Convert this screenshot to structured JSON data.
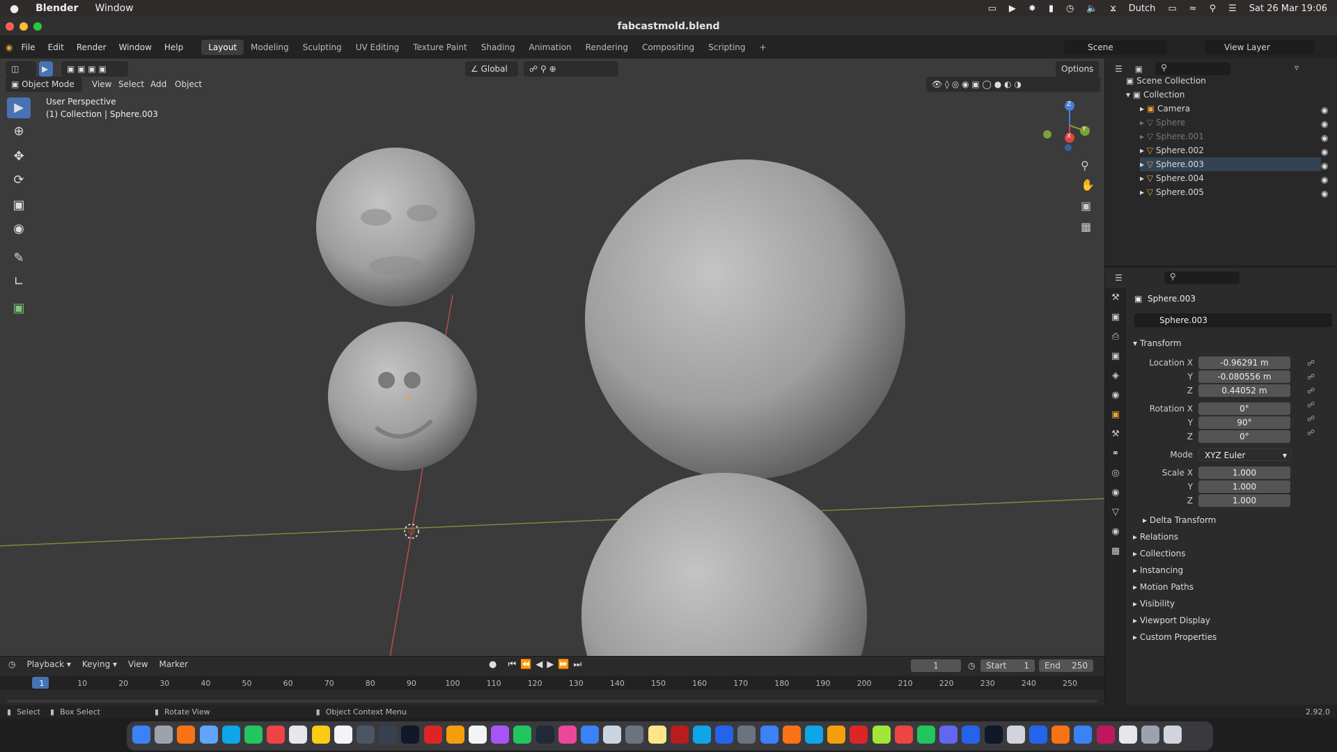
{
  "macbar": {
    "apple": "",
    "app": "Blender",
    "menu": "Window",
    "keyboard": "Dutch",
    "datetime": "Sat 26 Mar  19:06"
  },
  "window": {
    "title": "fabcastmold.blend"
  },
  "topbar": {
    "menus": [
      "File",
      "Edit",
      "Render",
      "Window",
      "Help"
    ],
    "workspaces": [
      "Layout",
      "Modeling",
      "Sculpting",
      "UV Editing",
      "Texture Paint",
      "Shading",
      "Animation",
      "Rendering",
      "Compositing",
      "Scripting"
    ],
    "active_workspace": "Layout",
    "scene": "Scene",
    "view_layer": "View Layer"
  },
  "viewport": {
    "mode": "Object Mode",
    "menus": [
      "View",
      "Select",
      "Add",
      "Object"
    ],
    "orientation": "Global",
    "options": "Options",
    "info_line1": "User Perspective",
    "info_line2": "(1) Collection | Sphere.003"
  },
  "gizmo": {
    "x": "X",
    "y": "Y",
    "z": "Z"
  },
  "outliner": {
    "root": "Scene Collection",
    "collection": "Collection",
    "items": [
      {
        "name": "Camera"
      },
      {
        "name": "Sphere"
      },
      {
        "name": "Sphere.001"
      },
      {
        "name": "Sphere.002"
      },
      {
        "name": "Sphere.003"
      },
      {
        "name": "Sphere.004"
      },
      {
        "name": "Sphere.005"
      }
    ]
  },
  "properties": {
    "object_name": "Sphere.003",
    "data_name": "Sphere.003",
    "transform": "Transform",
    "location_label": "Location X",
    "rotation_label": "Rotation X",
    "scale_label": "Scale X",
    "y": "Y",
    "z": "Z",
    "location": [
      "-0.96291 m",
      "-0.080556 m",
      "0.44052 m"
    ],
    "rotation": [
      "0°",
      "90°",
      "0°"
    ],
    "mode_label": "Mode",
    "mode": "XYZ Euler",
    "scale": [
      "1.000",
      "1.000",
      "1.000"
    ],
    "delta": "Delta Transform",
    "sections": [
      "Relations",
      "Collections",
      "Instancing",
      "Motion Paths",
      "Visibility",
      "Viewport Display",
      "Custom Properties"
    ]
  },
  "timeline": {
    "menus": [
      "Playback",
      "Keying",
      "View",
      "Marker"
    ],
    "current_frame": "1",
    "start_label": "Start",
    "start": "1",
    "end_label": "End",
    "end": "250",
    "ticks": [
      "1",
      "10",
      "20",
      "30",
      "40",
      "50",
      "60",
      "70",
      "80",
      "90",
      "100",
      "110",
      "120",
      "130",
      "140",
      "150",
      "160",
      "170",
      "180",
      "190",
      "200",
      "210",
      "220",
      "230",
      "240",
      "250"
    ]
  },
  "statusbar": {
    "select": "Select",
    "box_select": "Box Select",
    "rotate": "Rotate View",
    "context": "Object Context Menu",
    "version": "2.92.0"
  },
  "colors": {
    "accent": "#4772b3",
    "viewport_bg": "#3b3b3b",
    "orange": "#e8a33b"
  }
}
